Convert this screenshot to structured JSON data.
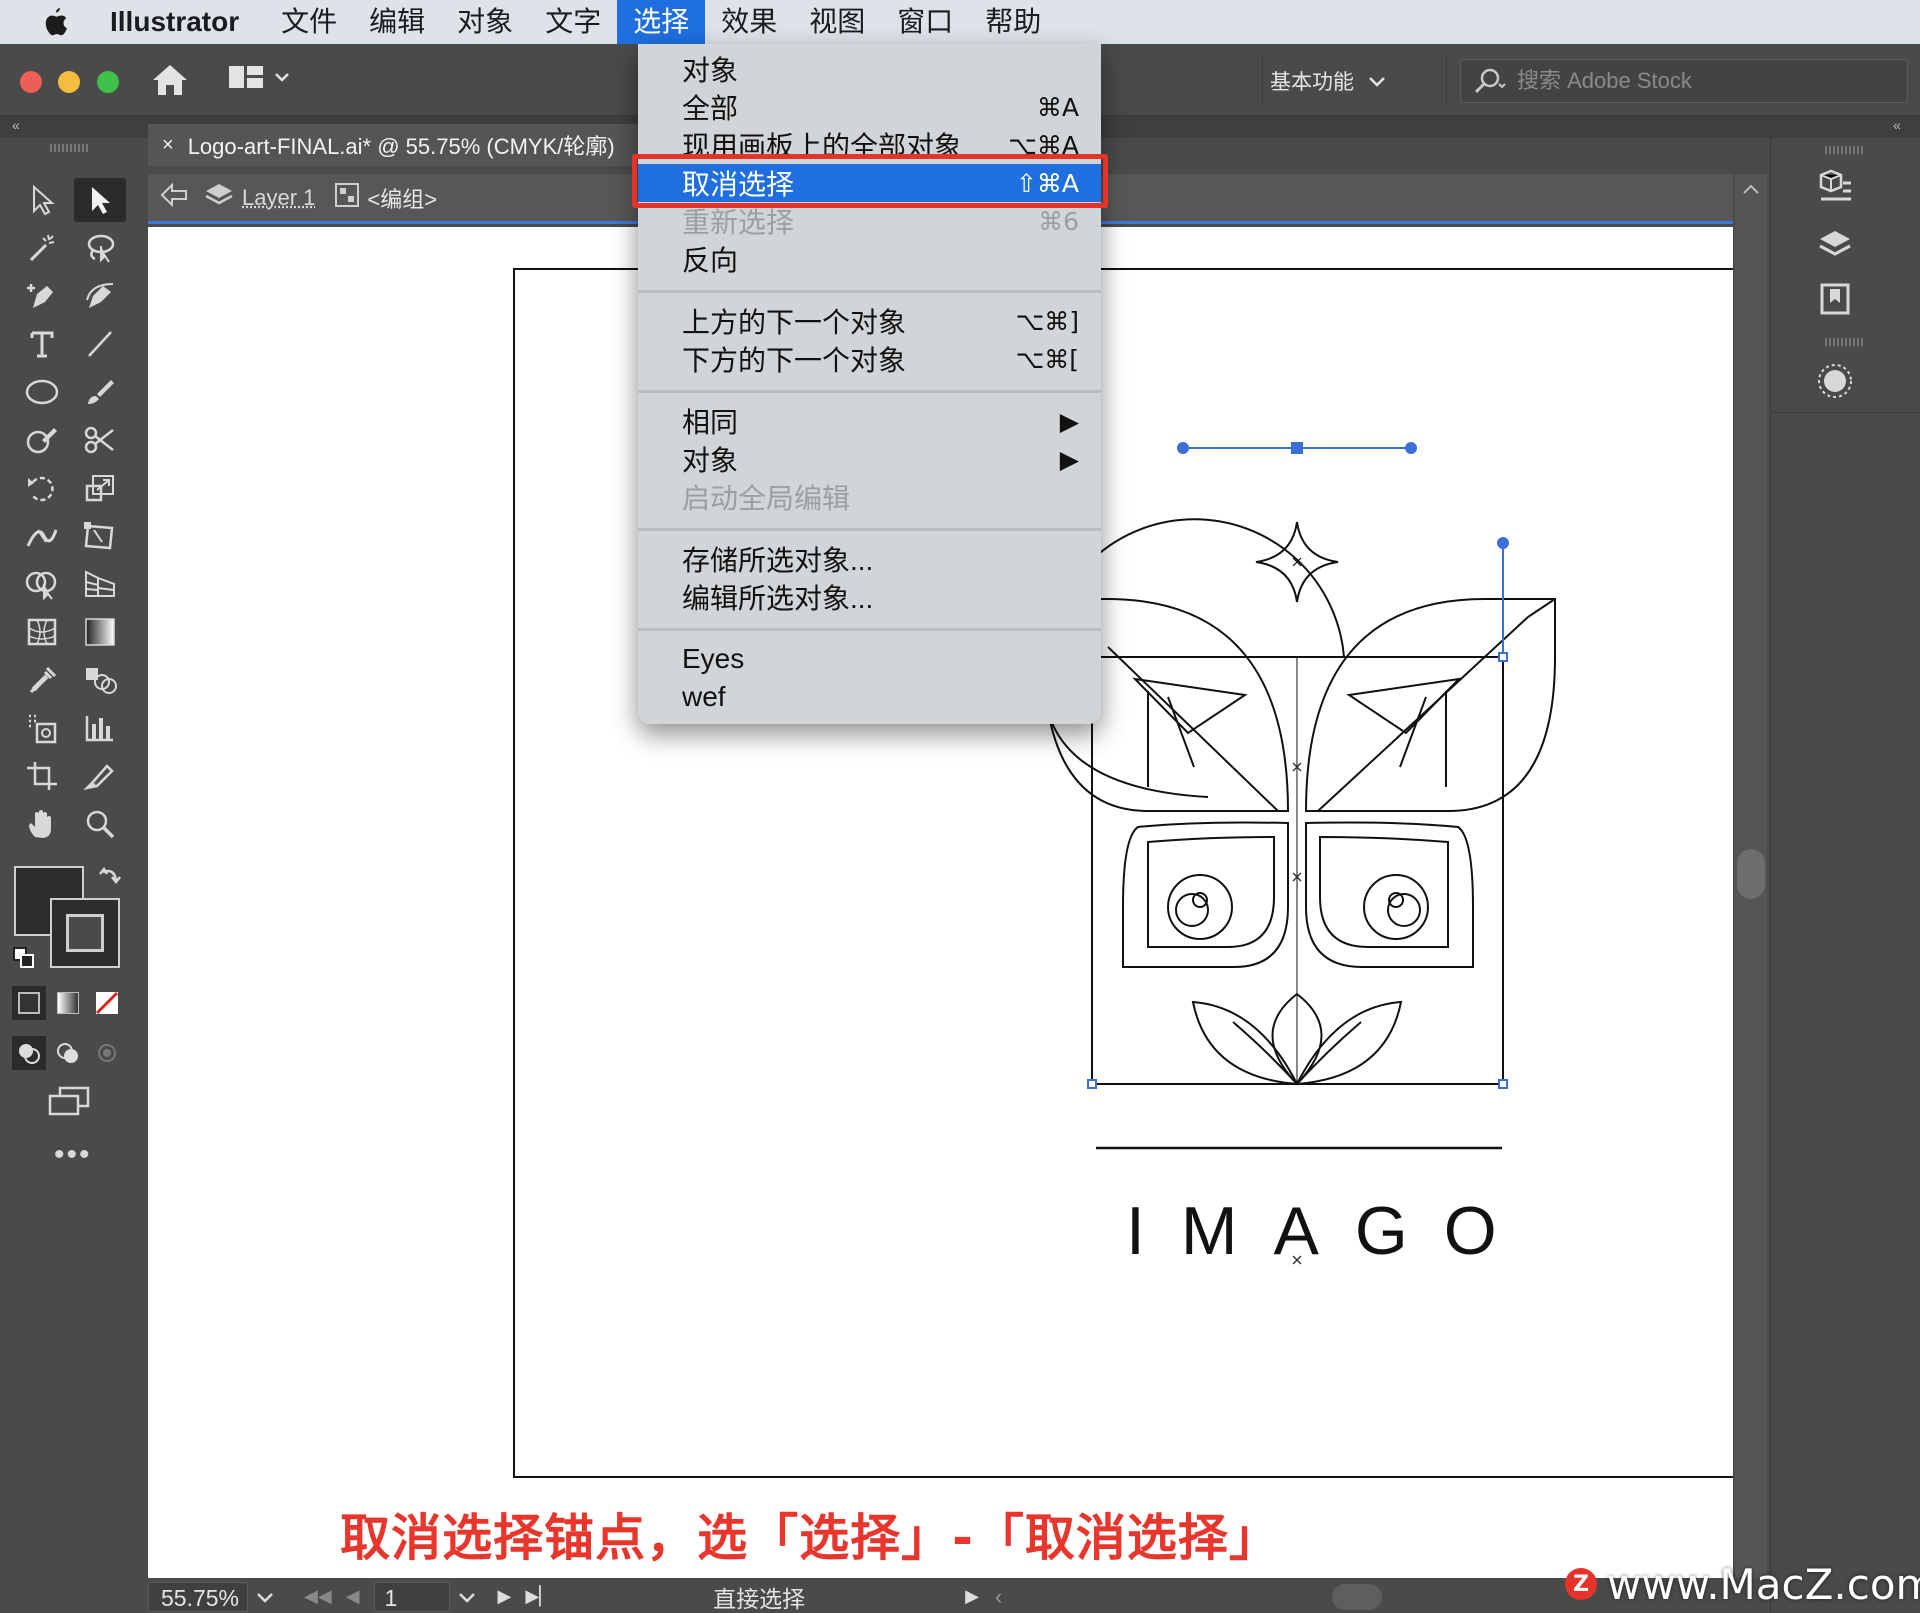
{
  "menubar": {
    "app_name": "Illustrator",
    "items": [
      "文件",
      "编辑",
      "对象",
      "文字",
      "选择",
      "效果",
      "视图",
      "窗口",
      "帮助"
    ],
    "active_item": "选择"
  },
  "appbar": {
    "workspace": "基本功能",
    "search_placeholder": "搜索 Adobe Stock"
  },
  "document": {
    "tab_close": "×",
    "tab_title": "Logo-art-FINAL.ai* @ 55.75% (CMYK/轮廓)",
    "layer_name": "Layer 1",
    "group_name": "<编组>"
  },
  "select_menu": {
    "items": [
      {
        "label": "对象",
        "shortcut": ""
      },
      {
        "label": "全部",
        "shortcut": "⌘A"
      },
      {
        "label": "现用画板上的全部对象",
        "shortcut": "⌥⌘A"
      },
      {
        "label": "取消选择",
        "shortcut": "⇧⌘A",
        "highlighted": true
      },
      {
        "label": "重新选择",
        "shortcut": "⌘6",
        "disabled": true
      },
      {
        "label": "反向",
        "shortcut": ""
      },
      {
        "label": "上方的下一个对象",
        "shortcut": "⌥⌘]"
      },
      {
        "label": "下方的下一个对象",
        "shortcut": "⌥⌘["
      },
      {
        "label": "相同",
        "shortcut": "▶"
      },
      {
        "label": "对象",
        "shortcut": "▶"
      },
      {
        "label": "启动全局编辑",
        "shortcut": "",
        "disabled": true
      },
      {
        "label": "存储所选对象...",
        "shortcut": ""
      },
      {
        "label": "编辑所选对象...",
        "shortcut": ""
      },
      {
        "label": "Eyes",
        "shortcut": ""
      },
      {
        "label": "wef",
        "shortcut": ""
      }
    ]
  },
  "artwork": {
    "logo_text": "IMAGO"
  },
  "statusbar": {
    "zoom": "55.75%",
    "artboard_number": "1",
    "current_tool": "直接选择"
  },
  "caption": "取消选择锚点，选「选择」-「取消选择」",
  "watermark": {
    "badge": "Z",
    "text": "www.MacZ.com"
  },
  "colors": {
    "menu_highlight": "#1f6fe0",
    "callout_red": "#e5332a",
    "selection_blue": "#3a6fd8"
  }
}
